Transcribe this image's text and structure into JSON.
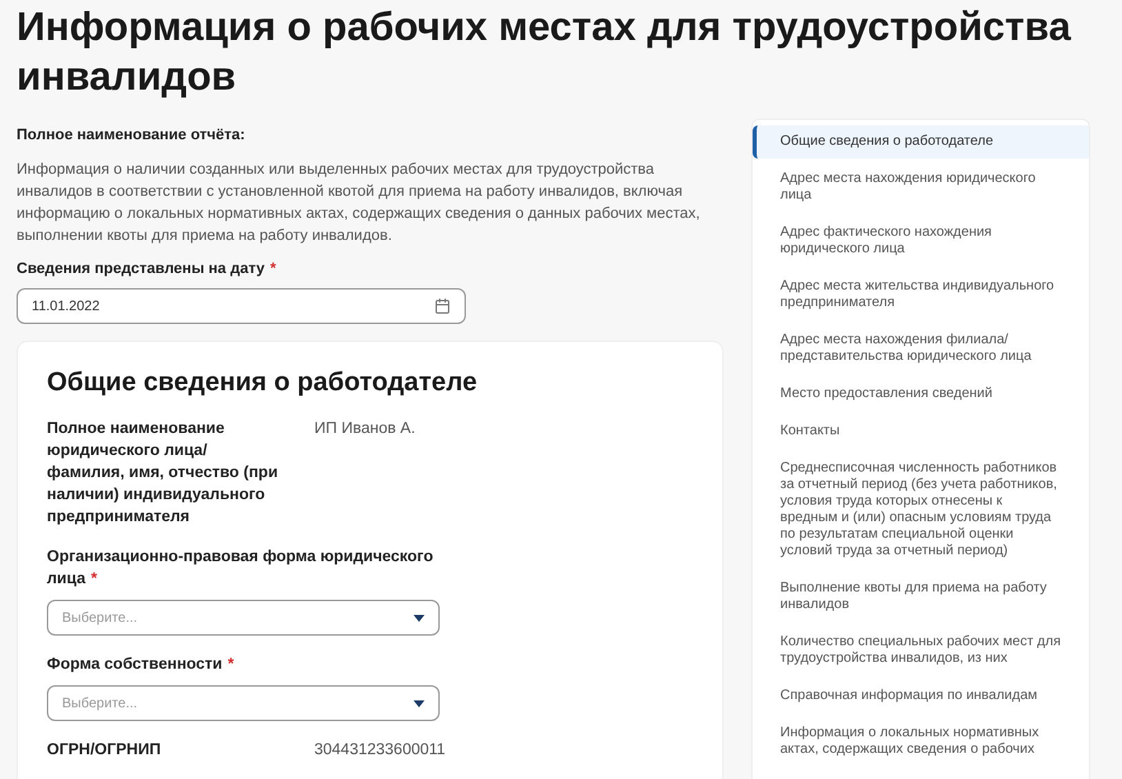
{
  "page_title": "Информация о рабочих местах для трудоустройства инвалидов",
  "report_name": {
    "label": "Полное наименование отчёта:",
    "text": "Информация о наличии созданных или выделенных рабочих местах для трудоустройства инвалидов в соответствии с установленной квотой для приема на работу инвалидов, включая информацию о локальных нормативных актах, содержащих сведения о данных рабочих местах, выполнении квоты для приема на работу инвалидов."
  },
  "date_field": {
    "label": "Сведения представлены на дату",
    "required_mark": "*",
    "value": "11.01.2022"
  },
  "section": {
    "title": "Общие сведения о работодателе",
    "fields": [
      {
        "kind": "text",
        "label": "Полное наименование юридического лица/ фамилия, имя, отчество (при наличии) индивидуального предпринимателя",
        "value": "ИП Иванов А."
      },
      {
        "kind": "select",
        "label": "Организационно-правовая форма юридического лица",
        "required_mark": "*",
        "placeholder": "Выберите..."
      },
      {
        "kind": "select",
        "label": "Форма собственности",
        "required_mark": "*",
        "placeholder": "Выберите..."
      },
      {
        "kind": "text",
        "label": "ОГРН/ОГРНИП",
        "value": "304431233600011"
      }
    ]
  },
  "nav": [
    {
      "label": "Общие сведения о работодателе",
      "selected": true
    },
    {
      "label": "Адрес места нахождения юридического лица",
      "selected": false
    },
    {
      "label": "Адрес фактического нахождения юридического лица",
      "selected": false
    },
    {
      "label": "Адрес места жительства индивидуального предпринимателя",
      "selected": false
    },
    {
      "label": "Адрес места нахождения филиала/ представительства юридического лица",
      "selected": false
    },
    {
      "label": "Место предоставления сведений",
      "selected": false
    },
    {
      "label": "Контакты",
      "selected": false
    },
    {
      "label": "Среднесписочная численность работников за отчетный период (без учета работников, условия труда которых отнесены к вредным и (или) опасным условиям труда по результатам специальной оценки условий труда за отчетный период)",
      "selected": false
    },
    {
      "label": "Выполнение квоты для приема на работу инвалидов",
      "selected": false
    },
    {
      "label": "Количество специальных рабочих мест для трудоустройства инвалидов, из них",
      "selected": false
    },
    {
      "label": "Справочная информация по инвалидам",
      "selected": false
    },
    {
      "label": "Информация о локальных нормативных актах, содержащих сведения о рабочих",
      "selected": false
    }
  ]
}
